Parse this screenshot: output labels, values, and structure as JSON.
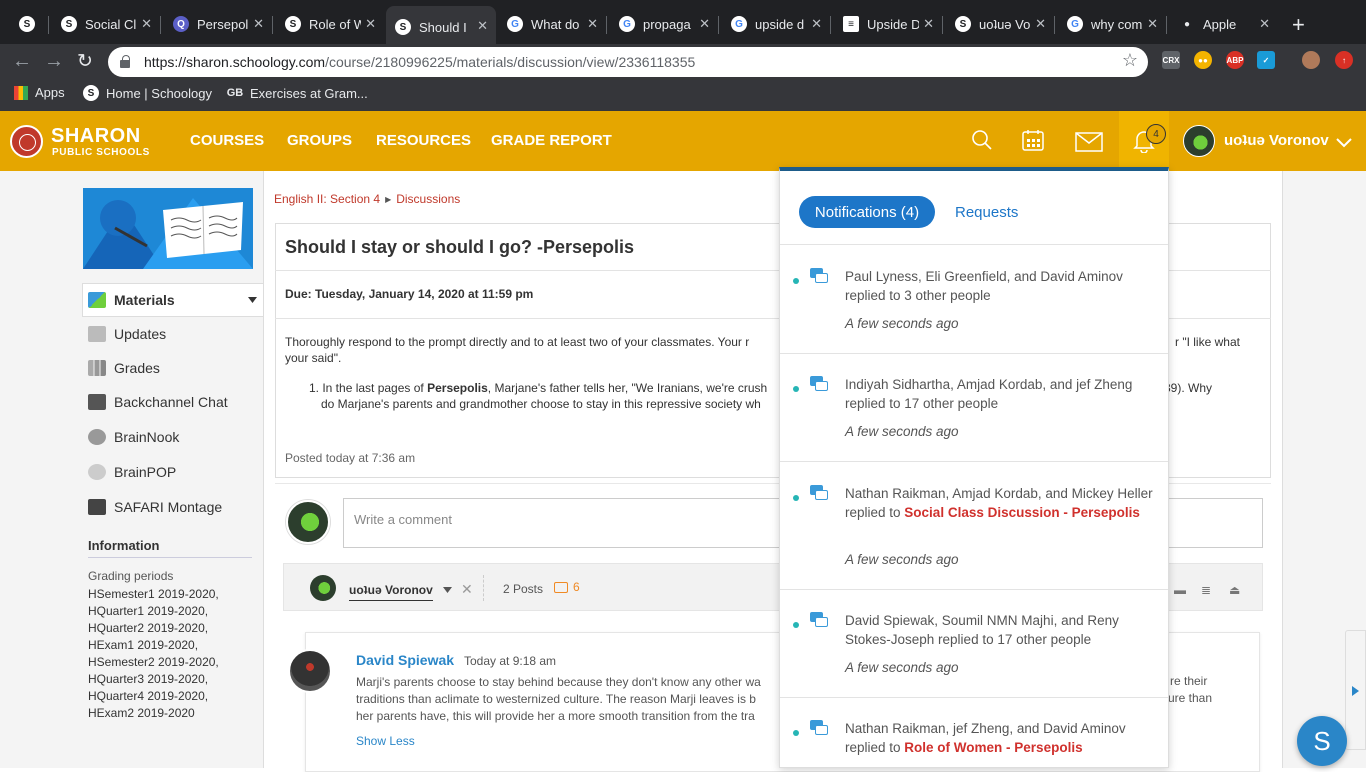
{
  "browser": {
    "tabs": [
      {
        "title": "",
        "favicon": "S",
        "color": "#ffffff"
      },
      {
        "title": "Social Cl",
        "favicon": "S",
        "color": "#ffffff"
      },
      {
        "title": "Persepol",
        "favicon": "Q",
        "color": "#5b5fc7"
      },
      {
        "title": "Role of W",
        "favicon": "S",
        "color": "#ffffff"
      },
      {
        "title": "Should I",
        "favicon": "S",
        "color": "#ffffff"
      },
      {
        "title": "What do",
        "favicon": "G",
        "color": "#ffffff"
      },
      {
        "title": "propaga",
        "favicon": "G",
        "color": "#ffffff"
      },
      {
        "title": "upside d",
        "favicon": "G",
        "color": "#ffffff"
      },
      {
        "title": "Upside D",
        "favicon": "doc",
        "color": "#ffffff"
      },
      {
        "title": "uoʇuǝ Vo",
        "favicon": "S",
        "color": "#ffffff"
      },
      {
        "title": "why com",
        "favicon": "G",
        "color": "#ffffff"
      },
      {
        "title": "Apple",
        "favicon": "apple",
        "color": "#ffffff"
      }
    ],
    "new_tab": "+",
    "url_host": "https://sharon.schoology.com",
    "url_path": "/course/2180996225/materials/discussion/view/2336118355",
    "bookmarks": [
      {
        "label": "Apps"
      },
      {
        "label": "Home | Schoology"
      },
      {
        "label": "Exercises at Gram..."
      }
    ]
  },
  "header": {
    "logo_title": "SHARON",
    "logo_subtitle": "PUBLIC SCHOOLS",
    "nav": [
      "COURSES",
      "GROUPS",
      "RESOURCES",
      "GRADE REPORT"
    ],
    "notification_count": "4",
    "user_name": "uoʇuǝ Voronov",
    "accent_color": "#e5a600"
  },
  "sidebar": {
    "items": [
      {
        "label": "Materials",
        "icon": "materials-icon"
      },
      {
        "label": "Updates",
        "icon": "updates-icon"
      },
      {
        "label": "Grades",
        "icon": "grades-icon"
      },
      {
        "label": "Backchannel Chat",
        "icon": "chat-icon"
      },
      {
        "label": "BrainNook",
        "icon": "brainnook-icon"
      },
      {
        "label": "BrainPOP",
        "icon": "brainpop-icon"
      },
      {
        "label": "SAFARI Montage",
        "icon": "safari-icon"
      }
    ],
    "info_heading": "Information",
    "grading_label": "Grading periods",
    "grading_periods": [
      "HSemester1 2019-2020,",
      "HQuarter1 2019-2020,",
      "HQuarter2 2019-2020,",
      "HExam1 2019-2020,",
      "HSemester2 2019-2020,",
      "HQuarter3 2019-2020,",
      "HQuarter4 2019-2020,",
      "HExam2 2019-2020"
    ]
  },
  "breadcrumb": {
    "course": "English II: Section 4",
    "section": "Discussions"
  },
  "discussion": {
    "title": "Should I stay or should I go? -Persepolis",
    "due": "Due: Tuesday, January 14, 2020 at 11:59 pm",
    "prompt": "Thoroughly respond to the prompt directly and to at least two of your classmates. Your r",
    "prompt_tail": "r \"I like what",
    "prompt_line2": "your said\".",
    "question_start": "In the last pages of ",
    "question_bold": "Persepolis",
    "question_rest": ", Marjane's father tells her, \"We Iranians, we're crush",
    "question_tail": "39). Why",
    "question_line2": "do Marjane's parents and grandmother choose to stay in this repressive society wh",
    "posted": "Posted today at 7:36 am",
    "comment_placeholder": "Write a comment"
  },
  "filter": {
    "user": "uoʇuǝ Voronov",
    "posts": "2 Posts",
    "comments": "6"
  },
  "reply": {
    "author": "David Spiewak",
    "time": "Today at 9:18 am",
    "line1": "Marji's parents choose to stay behind because they don't know any other wa",
    "line1_tail": "re their",
    "line2": "traditions than aclimate to westernized culture. The reason Marji leaves is b",
    "line2_tail": "ure than",
    "line3": "her parents have, this will provide her a more smooth transition from the tra",
    "show_less": "Show Less"
  },
  "notifications": {
    "tab_active": "Notifications (4)",
    "tab_other": "Requests",
    "items": [
      {
        "text": "Paul Lyness, Eli Greenfield, and David Aminov replied to 3 other people",
        "link": "",
        "time": "A few seconds ago"
      },
      {
        "text": "Indiyah Sidhartha, Amjad Kordab, and jef Zheng replied to 17 other people",
        "link": "",
        "time": "A few seconds ago"
      },
      {
        "text": "Nathan Raikman, Amjad Kordab, and Mickey Heller replied to ",
        "link": "Social Class Discussion - Persepolis",
        "time": "A few seconds ago"
      },
      {
        "text": "David Spiewak, Soumil NMN Majhi, and Reny Stokes-Joseph replied to 17 other people",
        "link": "",
        "time": "A few seconds ago"
      },
      {
        "text": "Nathan Raikman, jef Zheng, and David Aminov replied to ",
        "link": "Role of Women - Persepolis",
        "time": ""
      }
    ]
  },
  "fab_label": "S"
}
